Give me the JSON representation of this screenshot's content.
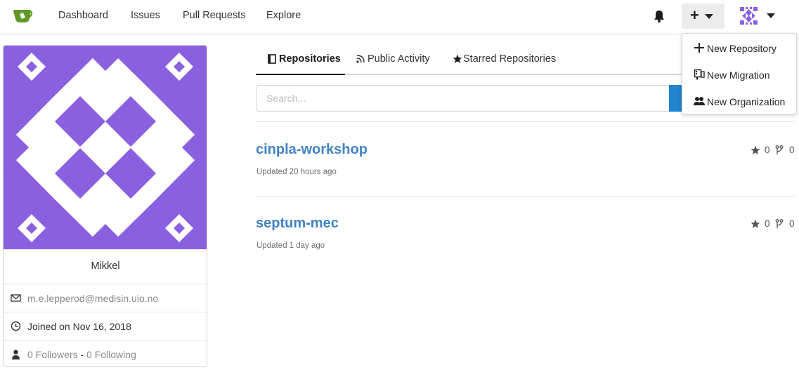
{
  "nav": {
    "logo_icon": "gitea-logo-icon",
    "items": [
      "Dashboard",
      "Issues",
      "Pull Requests",
      "Explore"
    ],
    "notification_icon": "bell-icon",
    "create_icon": "plus-icon",
    "avatar_icon": "user-avatar-identicon"
  },
  "create_menu": {
    "items": [
      {
        "label": "New Repository",
        "icon": "plus-icon"
      },
      {
        "label": "New Migration",
        "icon": "repo-clone-icon"
      },
      {
        "label": "New Organization",
        "icon": "organization-icon"
      }
    ]
  },
  "profile": {
    "name": "Mikkel",
    "email": "m.e.lepperod@medisin.uio.no",
    "joined": "Joined on Nov 16, 2018",
    "followers": "0 Followers",
    "separator": " - ",
    "following": "0 Following",
    "avatar_color": "#8a5fe0"
  },
  "tabs": [
    {
      "label": "Repositories",
      "icon": "book-icon",
      "active": true
    },
    {
      "label": "Public Activity",
      "icon": "rss-icon",
      "active": false
    },
    {
      "label": "Starred Repositories",
      "icon": "star-icon",
      "active": false
    }
  ],
  "search": {
    "placeholder": "Search...",
    "value": ""
  },
  "repos": [
    {
      "name": "cinpla-workshop",
      "updated": "Updated 20 hours ago",
      "stars": "0",
      "forks": "0"
    },
    {
      "name": "septum-mec",
      "updated": "Updated 1 day ago",
      "stars": "0",
      "forks": "0"
    }
  ],
  "colors": {
    "link": "#4183c4",
    "accent": "#2185d0",
    "logo_green": "#609926"
  }
}
